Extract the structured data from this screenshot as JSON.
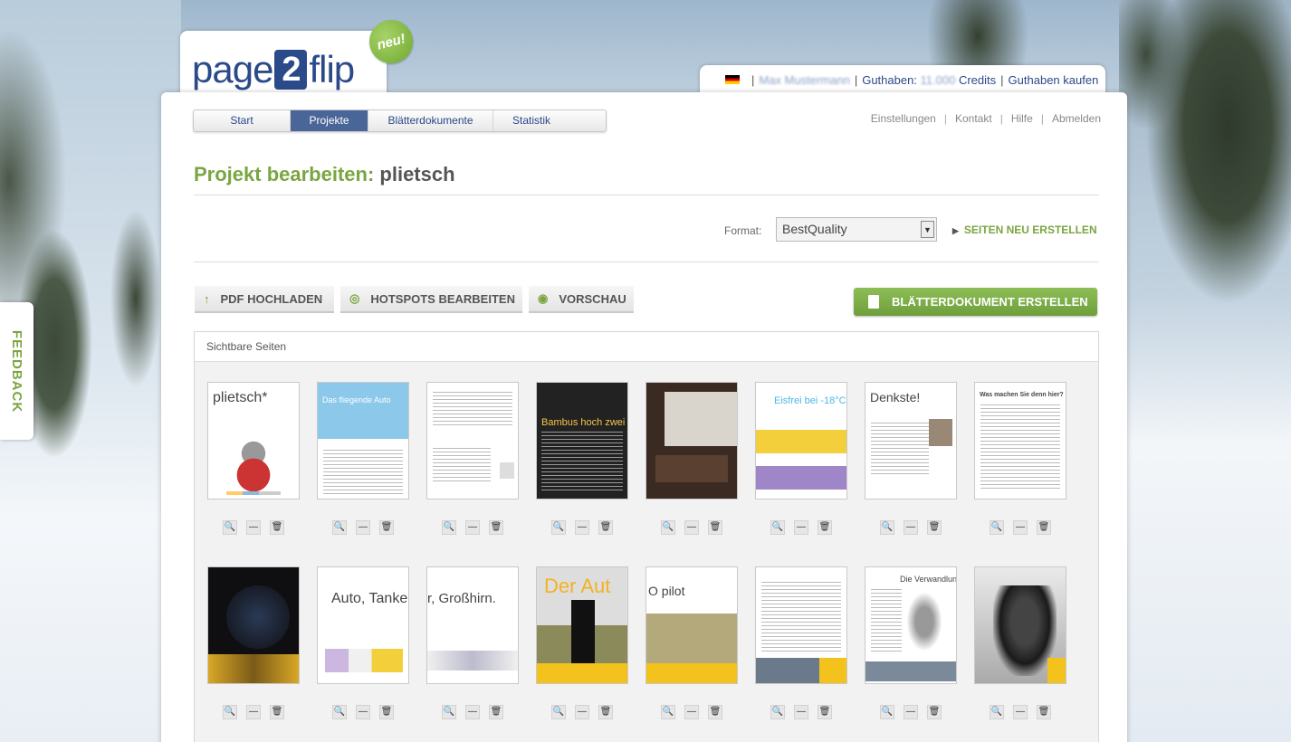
{
  "logo": {
    "part1": "page",
    "part2": "2",
    "part3": "flip",
    "badge": "neu!"
  },
  "account": {
    "user": "Max Mustermann",
    "credits_label": "Guthaben:",
    "credits_value": "11.000",
    "credits_unit": "Credits",
    "buy_link": "Guthaben kaufen"
  },
  "mainnav": [
    "Start",
    "Projekte",
    "Blätterdokumente",
    "Statistik"
  ],
  "topnav": [
    "Einstellungen",
    "Kontakt",
    "Hilfe",
    "Abmelden"
  ],
  "heading": {
    "label": "Projekt bearbeiten:",
    "project": "plietsch"
  },
  "format": {
    "label": "Format:",
    "value": "BestQuality",
    "rebuild": "SEITEN NEU ERSTELLEN"
  },
  "toolbar": {
    "upload": "PDF HOCHLADEN",
    "hotspots": "HOTSPOTS BEARBEITEN",
    "preview": "VORSCHAU",
    "create": "BLÄTTERDOKUMENT ERSTELLEN"
  },
  "pages": {
    "title": "Sichtbare Seiten",
    "row1": [
      "plietsch*",
      "Das fliegende Auto",
      "",
      "Bambus hoch zwei",
      "",
      "Eisfrei bei -18°C",
      "Denkste!",
      "Was machen Sie denn hier?"
    ],
    "row2": [
      "",
      "Auto, Tanke",
      "r, Großhirn.",
      "Der Aut",
      "O pilot",
      "",
      "Die Verwandlung",
      ""
    ]
  },
  "feedback": "FEEDBACK"
}
